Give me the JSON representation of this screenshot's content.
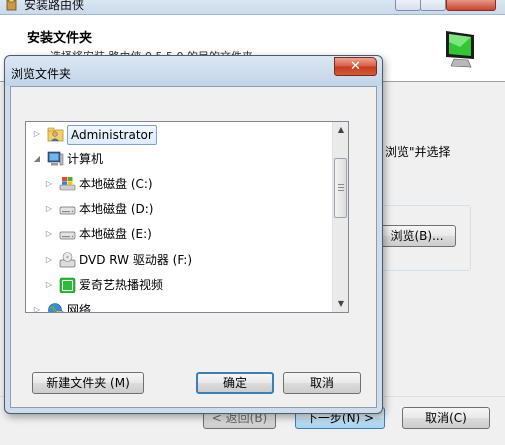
{
  "installer": {
    "title": "安装路由侠",
    "header_title": "安装文件夹",
    "header_subtitle": "选择将安装 路由侠 0.5.5.0 的目的文件夹。",
    "body_text_fragment": "浏览\"并选择",
    "browse_button": "浏览(B)...",
    "back_button": "< 返回(B)",
    "next_button": "下一步(N) >",
    "cancel_button": "取消(C)"
  },
  "dialog": {
    "title": "浏览文件夹",
    "close_glyph": "✕",
    "tree": [
      {
        "label": "Administrator",
        "icon": "user-folder-icon",
        "level": 0,
        "expanded": false,
        "selected": true
      },
      {
        "label": "计算机",
        "icon": "computer-icon",
        "level": 0,
        "expanded": true,
        "selected": false
      },
      {
        "label": "本地磁盘 (C:)",
        "icon": "system-drive-icon",
        "level": 1,
        "expanded": false,
        "selected": false
      },
      {
        "label": "本地磁盘 (D:)",
        "icon": "hard-drive-icon",
        "level": 1,
        "expanded": false,
        "selected": false
      },
      {
        "label": "本地磁盘 (E:)",
        "icon": "hard-drive-icon",
        "level": 1,
        "expanded": false,
        "selected": false
      },
      {
        "label": "DVD RW 驱动器 (F:)",
        "icon": "dvd-drive-icon",
        "level": 1,
        "expanded": false,
        "selected": false
      },
      {
        "label": "爱奇艺热播视频",
        "icon": "iqiyi-icon",
        "level": 1,
        "expanded": false,
        "selected": false
      },
      {
        "label": "网络",
        "icon": "network-icon",
        "level": 0,
        "expanded": false,
        "selected": false
      }
    ],
    "new_folder_button": "新建文件夹 (M)",
    "ok_button": "确定",
    "cancel_button": "取消"
  },
  "colors": {
    "selection_border": "#7da2ce",
    "close_red": "#c13d22",
    "dialog_frame": "#cfdceb"
  }
}
